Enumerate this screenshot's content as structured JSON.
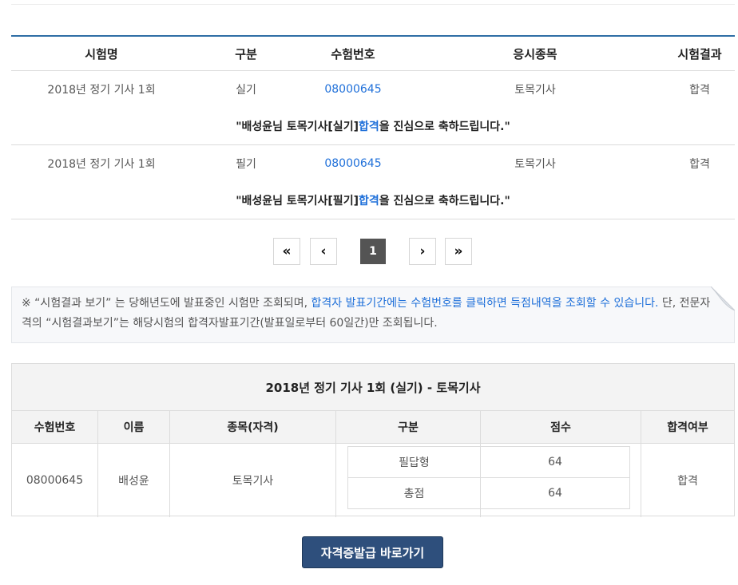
{
  "results_table": {
    "headers": [
      "시험명",
      "구분",
      "수험번호",
      "응시종목",
      "시험결과"
    ],
    "rows": [
      {
        "exam_name": "2018년 정기 기사 1회",
        "type": "실기",
        "exam_number": "08000645",
        "subject": "토목기사",
        "result": "합격",
        "message": {
          "prefix": "\"배성윤님 토목기사[실기] ",
          "highlight": "합격",
          "suffix": "을 진심으로 축하드립니다.\""
        }
      },
      {
        "exam_name": "2018년 정기 기사 1회",
        "type": "필기",
        "exam_number": "08000645",
        "subject": "토목기사",
        "result": "합격",
        "message": {
          "prefix": "\"배성윤님 토목기사[필기] ",
          "highlight": "합격",
          "suffix": "을 진심으로 축하드립니다.\""
        }
      }
    ]
  },
  "pagination": {
    "first": "«",
    "prev": "‹",
    "current": "1",
    "next": "›",
    "last": "»"
  },
  "notice": {
    "part1": "※ “시험결과 보기” 는 당해년도에 발표중인 시험만 조회되며, ",
    "link": "합격자 발표기간에는 수험번호를 클릭하면 득점내역을 조회할 수 있습니다.",
    "part2": " 단, 전문자격의 “시험결과보기”는 해당시험의 합격자발표기간(발표일로부터 60일간)만 조회됩니다."
  },
  "detail": {
    "title": "2018년 정기 기사 1회 (실기) - 토목기사",
    "headers": [
      "수험번호",
      "이름",
      "종목(자격)",
      "구분",
      "점수",
      "합격여부"
    ],
    "exam_number": "08000645",
    "name": "배성윤",
    "subject": "토목기사",
    "scores": [
      {
        "type": "필답형",
        "score": "64"
      },
      {
        "type": "총점",
        "score": "64"
      }
    ],
    "result": "합격"
  },
  "certificate_button": "자격증발급 바로가기",
  "colors": {
    "accent_blue": "#1e6fd9",
    "header_line": "#2f6ea5",
    "button_bg": "#2e4f7c"
  }
}
